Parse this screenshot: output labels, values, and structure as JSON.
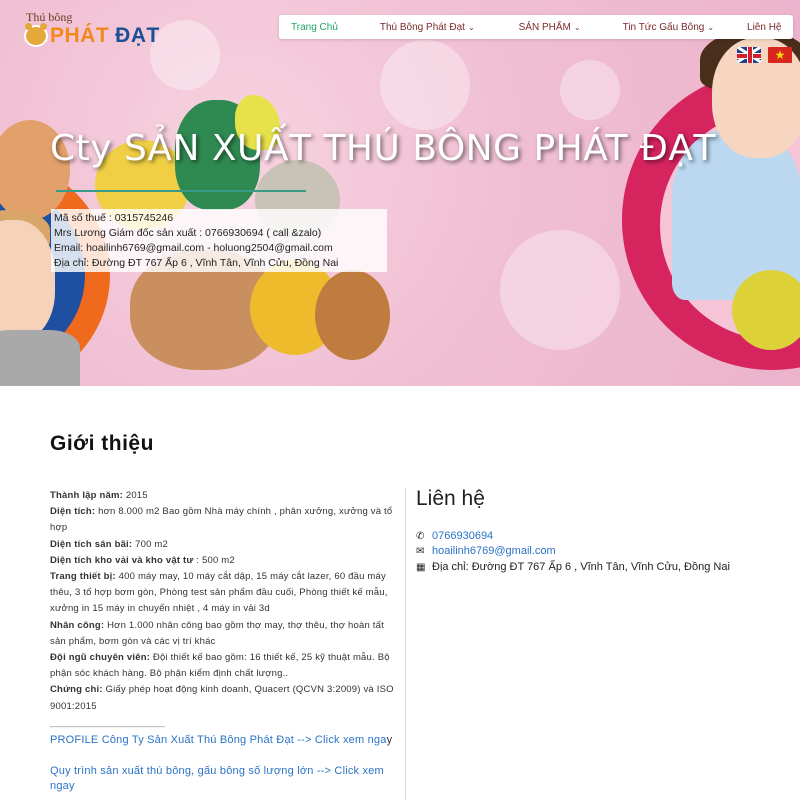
{
  "logo": {
    "small": "Thú bông",
    "brand_part1": "PHÁT",
    "brand_part2": "ĐẠT"
  },
  "nav": {
    "items": [
      {
        "label": "Trang Chủ",
        "active": true,
        "has_caret": false
      },
      {
        "label": "Thú Bông Phát Đạt",
        "active": false,
        "has_caret": true
      },
      {
        "label": "SẢN PHẨM",
        "active": false,
        "has_caret": true
      },
      {
        "label": "Tin Tức Gấu Bông",
        "active": false,
        "has_caret": true
      },
      {
        "label": "Liên Hệ",
        "active": false,
        "has_caret": false
      }
    ]
  },
  "flags": [
    {
      "icon": "uk-flag-icon"
    },
    {
      "icon": "vn-flag-icon",
      "glyph": "★"
    }
  ],
  "hero": {
    "title": "Cty SẢN XUẤT THÚ BÔNG PHÁT ĐẠT",
    "info": [
      "Mã số thuế : 0315745246",
      "Mrs Lương Giám đốc sản xuất : 0766930694 ( call &zalo)",
      "Email: hoailinh6769@gmail.com - holuong2504@gmail.com",
      "Địa chỉ: Đường ĐT 767 Ấp 6 , Vĩnh Tân, Vĩnh Cửu, Đồng Nai"
    ]
  },
  "intro": {
    "title": "Giới thiệu",
    "items": [
      {
        "label": "Thành lập năm:",
        "text": " 2015"
      },
      {
        "label": "Diện tích:",
        "text": "  hơn 8.000 m2 Bao gồm Nhà máy chính , phân xưởng, xưởng và tổ hợp"
      },
      {
        "label": "Diện tích sân bãi:",
        "text": " 700 m2"
      },
      {
        "label": "Diện tích kho vải và kho vật tư",
        "text": " : 500 m2"
      },
      {
        "label": "Trang thiết bị:",
        "text": " 400 máy may, 10 máy cắt dập, 15 máy cắt lazer, 60 đầu máy thêu, 3 tổ hợp bơm gòn, Phòng test sản phẩm đầu cuối, Phòng thiết kế mẫu, xưởng in 15 máy in chuyển nhiệt , 4 máy in vải 3d"
      },
      {
        "label": "Nhân công:",
        "text": " Hơn 1.000 nhân công bao gồm  thợ may, thợ thêu, thợ hoàn tất sản phẩm, bơm gòn và các vị trí khác"
      },
      {
        "label": "Đội ngũ chuyên viên:",
        "text": " Đội thiết kế bao gồm: 16  thiết kế, 25 kỹ thuật mẫu. Bộ phận sóc khách hàng. Bộ phận kiểm định chất lượng.."
      },
      {
        "label": "Chứng chỉ:",
        "text": " Giấy phép hoạt động kinh doanh, Quacert (QCVN 3:2009) và ISO 9001:2015"
      }
    ],
    "divider": "_____________________",
    "links": [
      {
        "text": " PROFILE Công Ty Sản Xuất Thú Bông Phát Đạt --> Click xem nga",
        "tail": "y"
      },
      {
        "text": "Quy trình sản xuất thú bông, gấu bông số lượng lớn --> Click xem ngay",
        "tail": ""
      }
    ]
  },
  "contact": {
    "title": "Liên hệ",
    "phone": {
      "icon": "phone-icon",
      "text": "0766930694"
    },
    "email": {
      "icon": "envelope-icon",
      "text": "hoailinh6769@gmail.com"
    },
    "address": {
      "icon": "map-icon",
      "text": "Địa chỉ: Đường ĐT 767 Ấp 6 , Vĩnh Tân, Vĩnh Cửu, Đồng Nai"
    }
  },
  "colors": {
    "nav_active": "#1fa56b",
    "nav_text": "#7b2a2a",
    "link": "#2a73c7",
    "hero_bg": "#f0bfd3"
  }
}
